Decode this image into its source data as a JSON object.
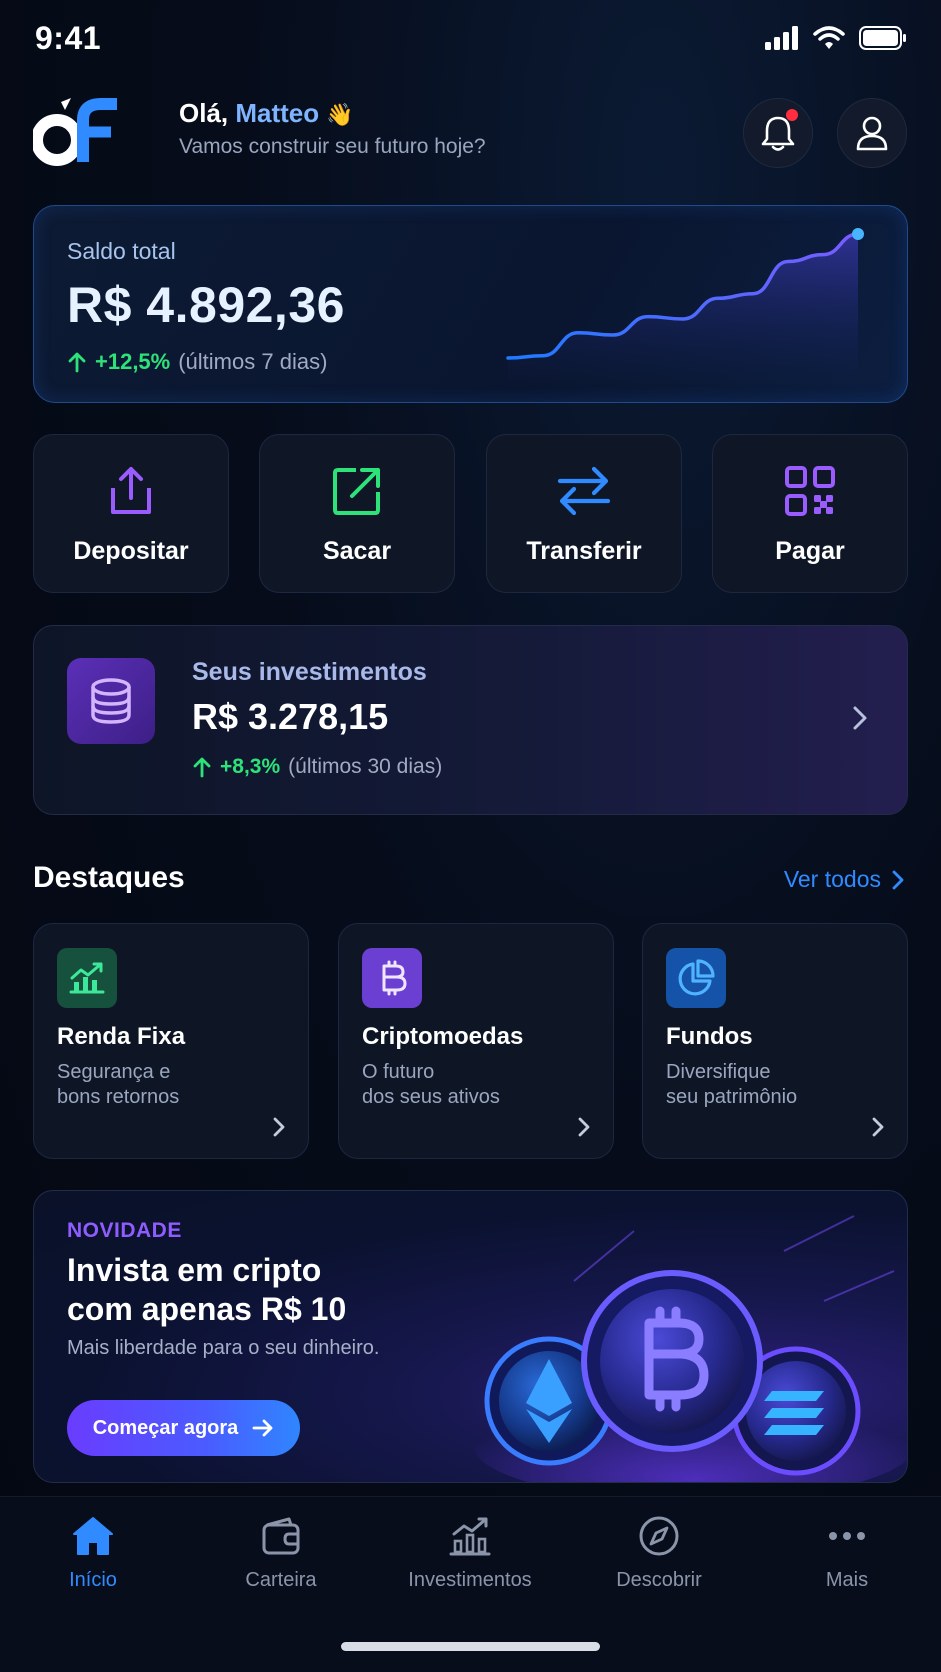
{
  "status_bar": {
    "time": "9:41"
  },
  "header": {
    "logo_text": "óf",
    "greeting_prefix": "Olá,",
    "user_name": "Matteo",
    "greeting_emoji": "👋",
    "subtitle": "Vamos construir seu futuro hoje?",
    "notification_badge": true
  },
  "balance": {
    "label": "Saldo total",
    "value": "R$ 4.892,36",
    "change": "+12,5%",
    "period": "(últimos 7 dias)",
    "trend_points": [
      2,
      3,
      13,
      12,
      20,
      19,
      28,
      30,
      44,
      47,
      56
    ]
  },
  "actions": [
    {
      "label": "Depositar",
      "icon": "upload-icon"
    },
    {
      "label": "Sacar",
      "icon": "external-link-icon"
    },
    {
      "label": "Transferir",
      "icon": "transfer-icon"
    },
    {
      "label": "Pagar",
      "icon": "qr-code-icon"
    }
  ],
  "investments": {
    "label": "Seus investimentos",
    "value": "R$ 3.278,15",
    "change": "+8,3%",
    "period": "(últimos 30 dias)"
  },
  "highlights": {
    "title": "Destaques",
    "see_all": "Ver todos",
    "items": [
      {
        "title": "Renda Fixa",
        "desc1": "Segurança e",
        "desc2": "bons retornos",
        "icon": "growth-chart-icon",
        "color": "#1f6b4d"
      },
      {
        "title": "Criptomoedas",
        "desc1": "O futuro",
        "desc2": "dos seus ativos",
        "icon": "bitcoin-icon",
        "color": "#6a3fd1"
      },
      {
        "title": "Fundos",
        "desc1": "Diversifique",
        "desc2": "seu patrimônio",
        "icon": "pie-chart-icon",
        "color": "#1553a8"
      }
    ]
  },
  "promo": {
    "tag": "NOVIDADE",
    "title_line1": "Invista em cripto",
    "title_line2": "com apenas R$ 10",
    "subtitle": "Mais liberdade para o seu dinheiro.",
    "button": "Começar agora"
  },
  "nav": [
    {
      "label": "Início",
      "icon": "home-icon",
      "active": true
    },
    {
      "label": "Carteira",
      "icon": "wallet-icon",
      "active": false
    },
    {
      "label": "Investimentos",
      "icon": "bar-chart-icon",
      "active": false
    },
    {
      "label": "Descobrir",
      "icon": "compass-icon",
      "active": false
    },
    {
      "label": "Mais",
      "icon": "more-icon",
      "active": false
    }
  ],
  "colors": {
    "accent_blue": "#2f8bff",
    "positive": "#2ee27a",
    "purple": "#8f5cff",
    "background": "#060c1a"
  }
}
